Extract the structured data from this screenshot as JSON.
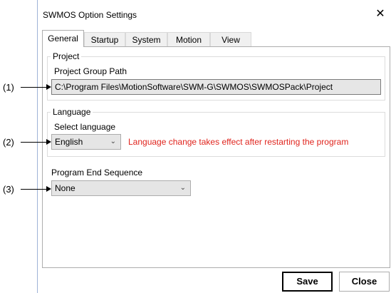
{
  "window": {
    "title": "SWMOS Option Settings",
    "close_glyph": "✕"
  },
  "tabs": [
    {
      "label": "General",
      "active": true
    },
    {
      "label": "Startup",
      "active": false
    },
    {
      "label": "System",
      "active": false
    },
    {
      "label": "Motion",
      "active": false
    },
    {
      "label": "View",
      "active": false
    }
  ],
  "project": {
    "group_title": "Project",
    "path_label": "Project Group Path",
    "path_value": "C:\\Program Files\\MotionSoftware\\SWM-G\\SWMOS\\SWMOSPack\\Project"
  },
  "language": {
    "group_title": "Language",
    "select_label": "Select language",
    "selected": "English",
    "note": "Language change takes effect after restarting the program",
    "note_color": "#e0241d"
  },
  "program_end": {
    "label": "Program End Sequence",
    "selected": "None"
  },
  "callouts": [
    "(1)",
    "(2)",
    "(3)"
  ],
  "buttons": {
    "save": "Save",
    "close": "Close"
  },
  "icons": {
    "dropdown": "chevron-down-icon",
    "close": "close-icon"
  }
}
